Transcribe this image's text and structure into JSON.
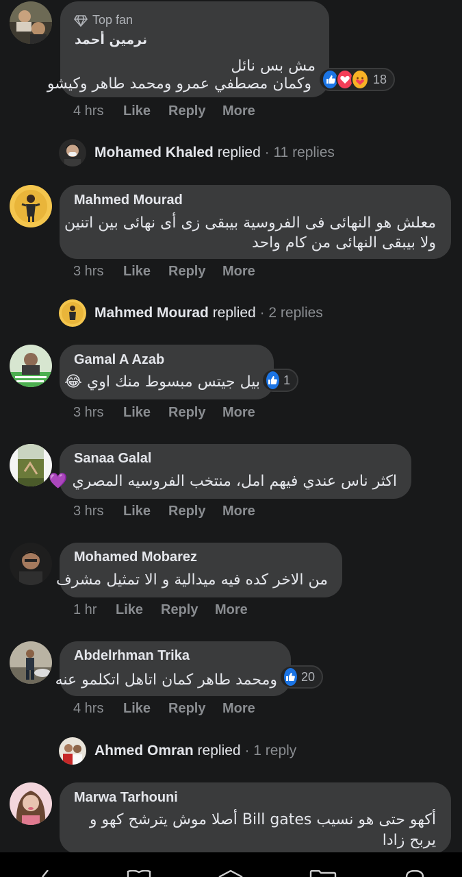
{
  "comments": [
    {
      "badge": "Top fan",
      "author": "نرمين أحمد",
      "lines": [
        "مش بس نائل",
        "وكمان مصطفي عمرو ومحمد طاهر وكيشو"
      ],
      "reactions": {
        "types": [
          "like",
          "love",
          "care"
        ],
        "count": "18"
      },
      "time": "4 hrs"
    },
    {
      "author": "Mahmed Mourad",
      "lines": [
        "معلش هو النهائى فى الفروسية بيبقى زى أى نهائى بين اتنين",
        "ولا بيبقى النهائى من كام واحد"
      ],
      "time": "3 hrs"
    },
    {
      "author": "Gamal A Azab",
      "lines": [
        "بيل جيتس مبسوط منك اوي 😂"
      ],
      "reactions": {
        "types": [
          "like"
        ],
        "count": "1"
      },
      "time": "3 hrs"
    },
    {
      "author": "Sanaa Galal",
      "lines": [
        "اكثر ناس عندي فيهم امل، منتخب الفروسيه المصري 💜"
      ],
      "time": "3 hrs"
    },
    {
      "author": "Mohamed Mobarez",
      "lines": [
        "من الاخر كده فيه ميدالية و الا تمثيل مشرف"
      ],
      "time": "1 hr"
    },
    {
      "author": "Abdelrhman Trika",
      "lines": [
        "ومحمد طاهر كمان اتاهل اتكلمو عنه"
      ],
      "reactions": {
        "types": [
          "like"
        ],
        "count": "20"
      },
      "time": "4 hrs"
    },
    {
      "author": "Marwa Tarhouni",
      "lines": [
        "أكهو حتى هو نسيب Bill gates أصلا موش يترشح كهو و",
        "يربح زادا"
      ]
    }
  ],
  "replies": [
    {
      "name": "Mohamed Khaled",
      "verb": "replied",
      "count": "11 replies"
    },
    {
      "name": "Mahmed Mourad",
      "verb": "replied",
      "count": "2 replies"
    },
    {
      "name": "Ahmed Omran",
      "verb": "replied",
      "count": "1 reply"
    }
  ],
  "actions": {
    "like": "Like",
    "reply": "Reply",
    "more": "More"
  },
  "icons": {
    "badge": "diamond-icon",
    "like": "thumbs-up-icon",
    "love": "heart-icon",
    "care": "care-emoji-icon"
  },
  "colors": {
    "background": "#18191a",
    "bubble": "#3a3b3c",
    "secondary_text": "#8a8d91",
    "like_blue": "#1b74e4",
    "love_red": "#f33e58"
  }
}
